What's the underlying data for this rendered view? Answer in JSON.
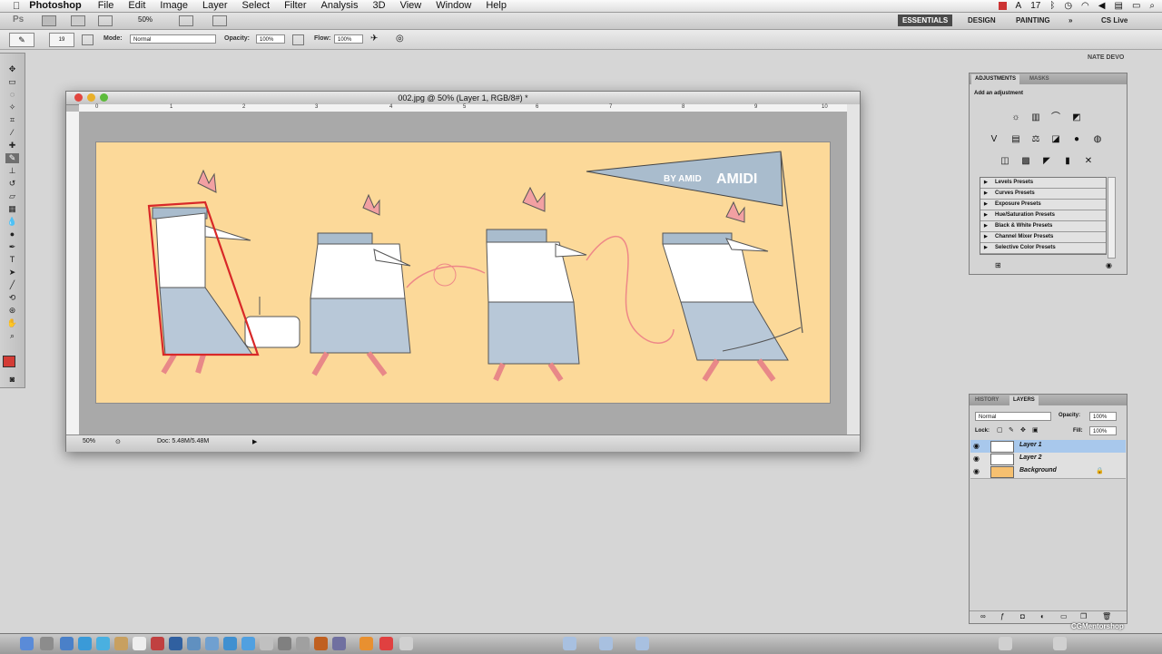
{
  "menubar": {
    "apple": "",
    "app_name": "Photoshop",
    "items": [
      "File",
      "Edit",
      "Image",
      "Layer",
      "Select",
      "Filter",
      "Analysis",
      "3D",
      "View",
      "Window",
      "Help"
    ],
    "clock": "17"
  },
  "appbar": {
    "logo": "Ps",
    "zoom": "50%",
    "workspaces": [
      "ESSENTIALS",
      "DESIGN",
      "PAINTING"
    ],
    "more": "»",
    "cs_live": "CS Live"
  },
  "options": {
    "brush_size": "19",
    "mode_label": "Mode:",
    "mode_value": "Normal",
    "opacity_label": "Opacity:",
    "opacity_value": "100%",
    "flow_label": "Flow:",
    "flow_value": "100%"
  },
  "user_label": "NATE DEVO",
  "document": {
    "title": "002.jpg @ 50% (Layer 1, RGB/8#) *",
    "ruler_numbers": [
      "0",
      "1",
      "2",
      "3",
      "4",
      "5",
      "6",
      "7",
      "8",
      "9",
      "10"
    ],
    "zoom": "50%",
    "doc_size": "Doc: 5.48M/5.48M",
    "artwork": {
      "pennant_text_1": "BY AMID",
      "pennant_text_2": "AMIDI"
    }
  },
  "adjustments": {
    "tabs": [
      "ADJUSTMENTS",
      "MASKS"
    ],
    "heading": "Add an adjustment",
    "presets": [
      "Levels Presets",
      "Curves Presets",
      "Exposure Presets",
      "Hue/Saturation Presets",
      "Black & White Presets",
      "Channel Mixer Presets",
      "Selective Color Presets"
    ]
  },
  "layers": {
    "tabs": [
      "HISTORY",
      "LAYERS"
    ],
    "blend_mode": "Normal",
    "opacity_label": "Opacity:",
    "opacity_value": "100%",
    "lock_label": "Lock:",
    "fill_label": "Fill:",
    "fill_value": "100%",
    "rows": [
      {
        "name": "Layer 1",
        "selected": true
      },
      {
        "name": "Layer 2",
        "selected": false
      },
      {
        "name": "Background",
        "selected": false,
        "locked": true
      }
    ]
  },
  "watermark": "CGMentorshop"
}
